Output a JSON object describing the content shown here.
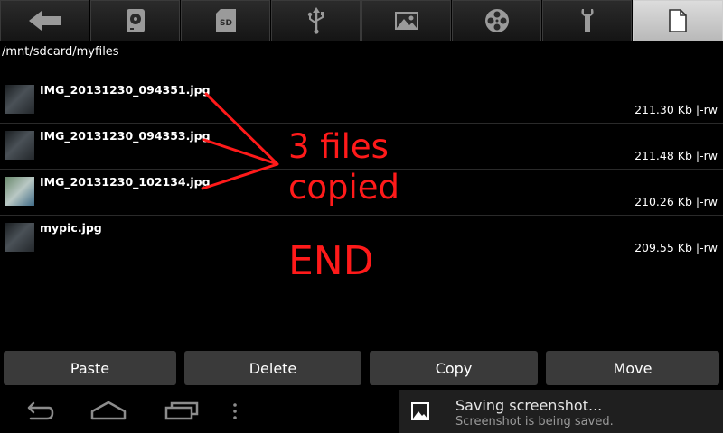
{
  "toolbar": {
    "tabs": [
      {
        "icon": "back-arrow-icon"
      },
      {
        "icon": "hard-disk-icon"
      },
      {
        "icon": "sd-card-icon",
        "label": "SD"
      },
      {
        "icon": "usb-icon"
      },
      {
        "icon": "picture-icon"
      },
      {
        "icon": "film-reel-icon"
      },
      {
        "icon": "wrench-icon"
      },
      {
        "icon": "document-icon",
        "active": true
      }
    ]
  },
  "path": "/mnt/sdcard/myfiles",
  "files": [
    {
      "name": "IMG_20131230_094351.jpg",
      "size": "211.30 Kb",
      "perm": "|-rw"
    },
    {
      "name": "IMG_20131230_094353.jpg",
      "size": "211.48 Kb",
      "perm": "|-rw"
    },
    {
      "name": "IMG_20131230_102134.jpg",
      "size": "210.26 Kb",
      "perm": "|-rw"
    },
    {
      "name": "mypic.jpg",
      "size": "209.55 Kb",
      "perm": "|-rw"
    }
  ],
  "annotation": {
    "line1": "3 files",
    "line2": "copied",
    "line3": "END",
    "color": "#ff1a1a"
  },
  "actions": {
    "paste": "Paste",
    "delete": "Delete",
    "copy": "Copy",
    "move": "Move"
  },
  "notification": {
    "title": "Saving screenshot...",
    "subtitle": "Screenshot is being saved."
  }
}
